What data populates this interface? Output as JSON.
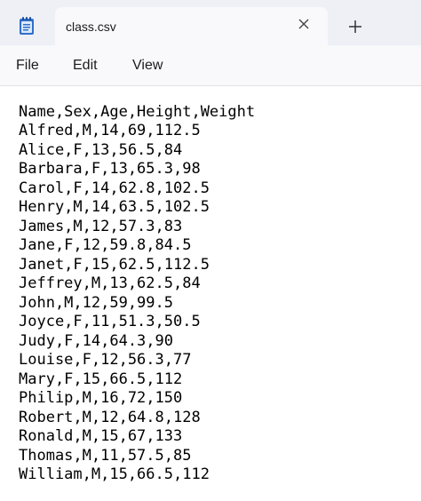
{
  "tab": {
    "title": "class.csv",
    "close_glyph": "✕",
    "new_tab_glyph": "+"
  },
  "menu": {
    "items": [
      "File",
      "Edit",
      "View"
    ]
  },
  "icons": {
    "app": "notepad-icon",
    "close": "close-icon",
    "add": "plus-icon"
  },
  "document": {
    "lines": [
      "Name,Sex,Age,Height,Weight",
      "Alfred,M,14,69,112.5",
      "Alice,F,13,56.5,84",
      "Barbara,F,13,65.3,98",
      "Carol,F,14,62.8,102.5",
      "Henry,M,14,63.5,102.5",
      "James,M,12,57.3,83",
      "Jane,F,12,59.8,84.5",
      "Janet,F,15,62.5,112.5",
      "Jeffrey,M,13,62.5,84",
      "John,M,12,59,99.5",
      "Joyce,F,11,51.3,50.5",
      "Judy,F,14,64.3,90",
      "Louise,F,12,56.3,77",
      "Mary,F,15,66.5,112",
      "Philip,M,16,72,150",
      "Robert,M,12,64.8,128",
      "Ronald,M,15,67,133",
      "Thomas,M,11,57.5,85",
      "William,M,15,66.5,112"
    ]
  }
}
